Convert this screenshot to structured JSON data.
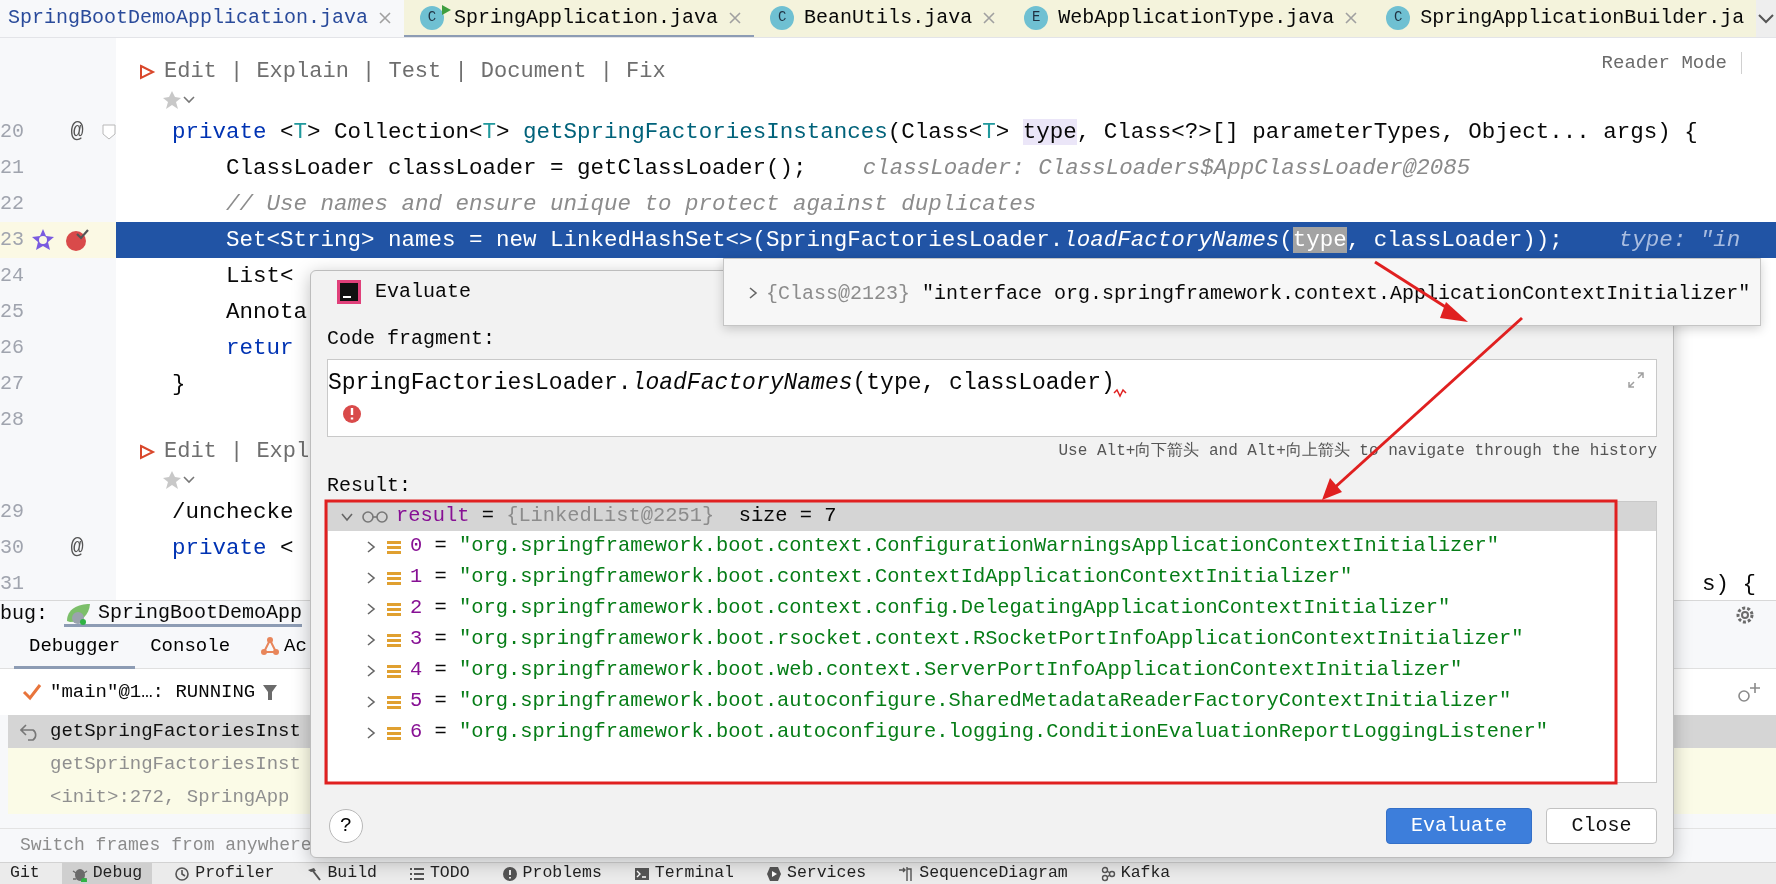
{
  "editor_tabs": [
    {
      "label": "SpringBootDemoApplication.java",
      "kind": "project",
      "selected": false,
      "closable": true
    },
    {
      "label": "SpringApplication.java",
      "kind": "library",
      "badge": "C",
      "runnable": true,
      "selected": true,
      "closable": true
    },
    {
      "label": "BeanUtils.java",
      "kind": "library",
      "badge": "C",
      "runnable": false,
      "selected": false,
      "closable": true
    },
    {
      "label": "WebApplicationType.java",
      "kind": "library",
      "badge": "E",
      "runnable": false,
      "selected": false,
      "closable": true
    },
    {
      "label": "SpringApplicationBuilder.ja",
      "kind": "library",
      "badge": "C",
      "runnable": false,
      "selected": false,
      "closable": false
    }
  ],
  "reader_mode": "Reader Mode",
  "editor": {
    "lines": [
      {
        "kind": "code",
        "current": false,
        "breakpoint": false,
        "foldable": false
      },
      {
        "kind": "code_vision",
        "text": "Edit | Explain | Test | Document | Fix"
      },
      {
        "kind": "ai_actions"
      },
      {
        "kind": "code",
        "number": "20",
        "gutter_mark": "@",
        "current": false,
        "breakpoint": false,
        "foldable": true,
        "tokens": [
          {
            "t": "private",
            "kind": "kw"
          },
          {
            "t": " <",
            "kind": "p"
          },
          {
            "t": "T",
            "kind": "tp"
          },
          {
            "t": "> Collection<",
            "kind": "p"
          },
          {
            "t": "T",
            "kind": "tp"
          },
          {
            "t": "> ",
            "kind": "p"
          },
          {
            "t": "getSpringFactoriesInstances",
            "kind": "fn"
          },
          {
            "t": "(Class<",
            "kind": "p"
          },
          {
            "t": "T",
            "kind": "tp"
          },
          {
            "t": "> ",
            "kind": "p"
          },
          {
            "t": "type",
            "kind": "hl"
          },
          {
            "t": ", Class<?>[] parameterTypes, Object... args) {",
            "kind": "p"
          }
        ],
        "children": [
          {
            "kind": "code",
            "number": "21",
            "current": false,
            "breakpoint": false,
            "foldable": false,
            "tokens": [
              {
                "t": "ClassLoader classLoader = getClassLoader();",
                "kind": "p"
              }
            ],
            "inlay": "classLoader: ClassLoaders$AppClassLoader@2085"
          },
          {
            "kind": "code",
            "number": "22",
            "current": false,
            "breakpoint": false,
            "foldable": false,
            "tokens": [
              {
                "t": "// Use names and ensure unique to protect against duplicates",
                "kind": "cm"
              }
            ]
          },
          {
            "kind": "code",
            "number": "23",
            "current": true,
            "breakpoint": true,
            "foldable": false,
            "tokens": [
              {
                "t": "Set<String> names = ",
                "kind": "p"
              },
              {
                "t": "new",
                "kind": "kw"
              },
              {
                "t": " LinkedHashSet<>(SpringFactoriesLoader.",
                "kind": "p"
              },
              {
                "t": "loadFactoryNames",
                "kind": "st"
              },
              {
                "t": "(",
                "kind": "p"
              },
              {
                "t": "type",
                "kind": "hl"
              },
              {
                "t": ", classLoader));",
                "kind": "p"
              }
            ],
            "inlay": "type: \"in"
          },
          {
            "kind": "code",
            "number": "24",
            "current": false,
            "breakpoint": false,
            "foldable": false,
            "tokens": [
              {
                "t": "List<",
                "kind": "p"
              }
            ]
          },
          {
            "kind": "code",
            "number": "25",
            "current": false,
            "breakpoint": false,
            "foldable": false,
            "tokens": [
              {
                "t": "Annota",
                "kind": "p"
              }
            ]
          },
          {
            "kind": "code",
            "number": "26",
            "current": false,
            "breakpoint": false,
            "foldable": false,
            "tokens": [
              {
                "t": "retur",
                "kind": "kw"
              }
            ]
          }
        ]
      },
      {
        "kind": "code",
        "number": "27",
        "current": false,
        "breakpoint": false,
        "foldable": false,
        "tokens": [
          {
            "t": "}",
            "kind": "p"
          }
        ]
      },
      {
        "kind": "code",
        "number": "28",
        "current": false,
        "breakpoint": false,
        "foldable": false
      },
      {
        "kind": "code_vision",
        "text": "Edit | Expl"
      },
      {
        "kind": "ai_actions"
      },
      {
        "kind": "code",
        "number": "29",
        "current": false,
        "breakpoint": false,
        "foldable": false,
        "tokens": [
          {
            "t": "/unchecke",
            "kind": "p"
          }
        ]
      },
      {
        "kind": "code",
        "number": "30",
        "gutter_mark": "@",
        "current": false,
        "breakpoint": false,
        "foldable": false,
        "tokens": [
          {
            "t": "private",
            "kind": "kw"
          },
          {
            "t": " <",
            "kind": "p"
          }
        ]
      },
      {
        "kind": "code",
        "number": "31",
        "current": false,
        "breakpoint": false,
        "foldable": false,
        "tail": "s) {"
      }
    ]
  },
  "debugger_tooltip": {
    "value_id": "{Class@2123}",
    "value": "\"interface org.springframework.context.ApplicationContextInitializer\"",
    "expanded": false
  },
  "evaluate_dialog": {
    "title": "Evaluate",
    "code_label": "Code fragment:",
    "code": "SpringFactoriesLoader.*loadFactoryNames*(type, classLoader)",
    "error": true,
    "hint": "Use Alt+向下箭头 and Alt+向上箭头 to navigate through the history",
    "result_label": "Result:",
    "result": {
      "name": "result",
      "eq": "=",
      "value": "{LinkedList@2251}",
      "size": "size = 7",
      "expanded": true,
      "selected": true,
      "children": [
        {
          "name": "0",
          "eq": "=",
          "value": "\"org.springframework.boot.context.ConfigurationWarningsApplicationContextInitializer\"",
          "expanded": false,
          "selected": false
        },
        {
          "name": "1",
          "eq": "=",
          "value": "\"org.springframework.boot.context.ContextIdApplicationContextInitializer\"",
          "expanded": false,
          "selected": false
        },
        {
          "name": "2",
          "eq": "=",
          "value": "\"org.springframework.boot.context.config.DelegatingApplicationContextInitializer\"",
          "expanded": false,
          "selected": false
        },
        {
          "name": "3",
          "eq": "=",
          "value": "\"org.springframework.boot.rsocket.context.RSocketPortInfoApplicationContextInitializer\"",
          "expanded": false,
          "selected": false
        },
        {
          "name": "4",
          "eq": "=",
          "value": "\"org.springframework.boot.web.context.ServerPortInfoApplicationContextInitializer\"",
          "expanded": false,
          "selected": false
        },
        {
          "name": "5",
          "eq": "=",
          "value": "\"org.springframework.boot.autoconfigure.SharedMetadataReaderFactoryContextInitializer\"",
          "expanded": false,
          "selected": false
        },
        {
          "name": "6",
          "eq": "=",
          "value": "\"org.springframework.boot.autoconfigure.logging.ConditionEvaluationReportLoggingListener\"",
          "expanded": false,
          "selected": false
        }
      ]
    },
    "help": "?",
    "buttons": [
      {
        "label": "Evaluate",
        "kind": "primary"
      },
      {
        "label": "Close",
        "kind": "secondary"
      }
    ]
  },
  "debug_panel": {
    "title": "bug:",
    "session": {
      "label": "SpringBootDemoApp",
      "selected": true
    },
    "tabs": [
      {
        "label": "Debugger",
        "kind": "plain",
        "selected": true
      },
      {
        "label": "Console",
        "kind": "plain",
        "selected": false
      },
      {
        "label": "Ac",
        "kind": "actuator",
        "selected": false
      }
    ],
    "thread": "\"main\"@1…: RUNNING",
    "frames": [
      {
        "label": "getSpringFactoriesInst",
        "kind": "current",
        "selected": true
      },
      {
        "label": "getSpringFactoriesInst",
        "kind": "library",
        "selected": false
      },
      {
        "label": "<init>:272, SpringApp",
        "kind": "library",
        "selected": false
      }
    ],
    "hint": "Switch frames from anywhere"
  },
  "tool_windows": [
    {
      "label": "Git",
      "kind": "plain",
      "selected": false
    },
    {
      "label": "Debug",
      "kind": "bug",
      "selected": true
    },
    {
      "label": "Profiler",
      "kind": "profiler",
      "selected": false
    },
    {
      "label": "Build",
      "kind": "hammer",
      "selected": false
    },
    {
      "label": "TODO",
      "kind": "list",
      "selected": false
    },
    {
      "label": "Problems",
      "kind": "alert",
      "selected": false
    },
    {
      "label": "Terminal",
      "kind": "terminal",
      "selected": false
    },
    {
      "label": "Services",
      "kind": "services",
      "selected": false
    },
    {
      "label": "SequenceDiagram",
      "kind": "sequence",
      "selected": false
    },
    {
      "label": "Kafka",
      "kind": "kafka",
      "selected": false
    }
  ]
}
